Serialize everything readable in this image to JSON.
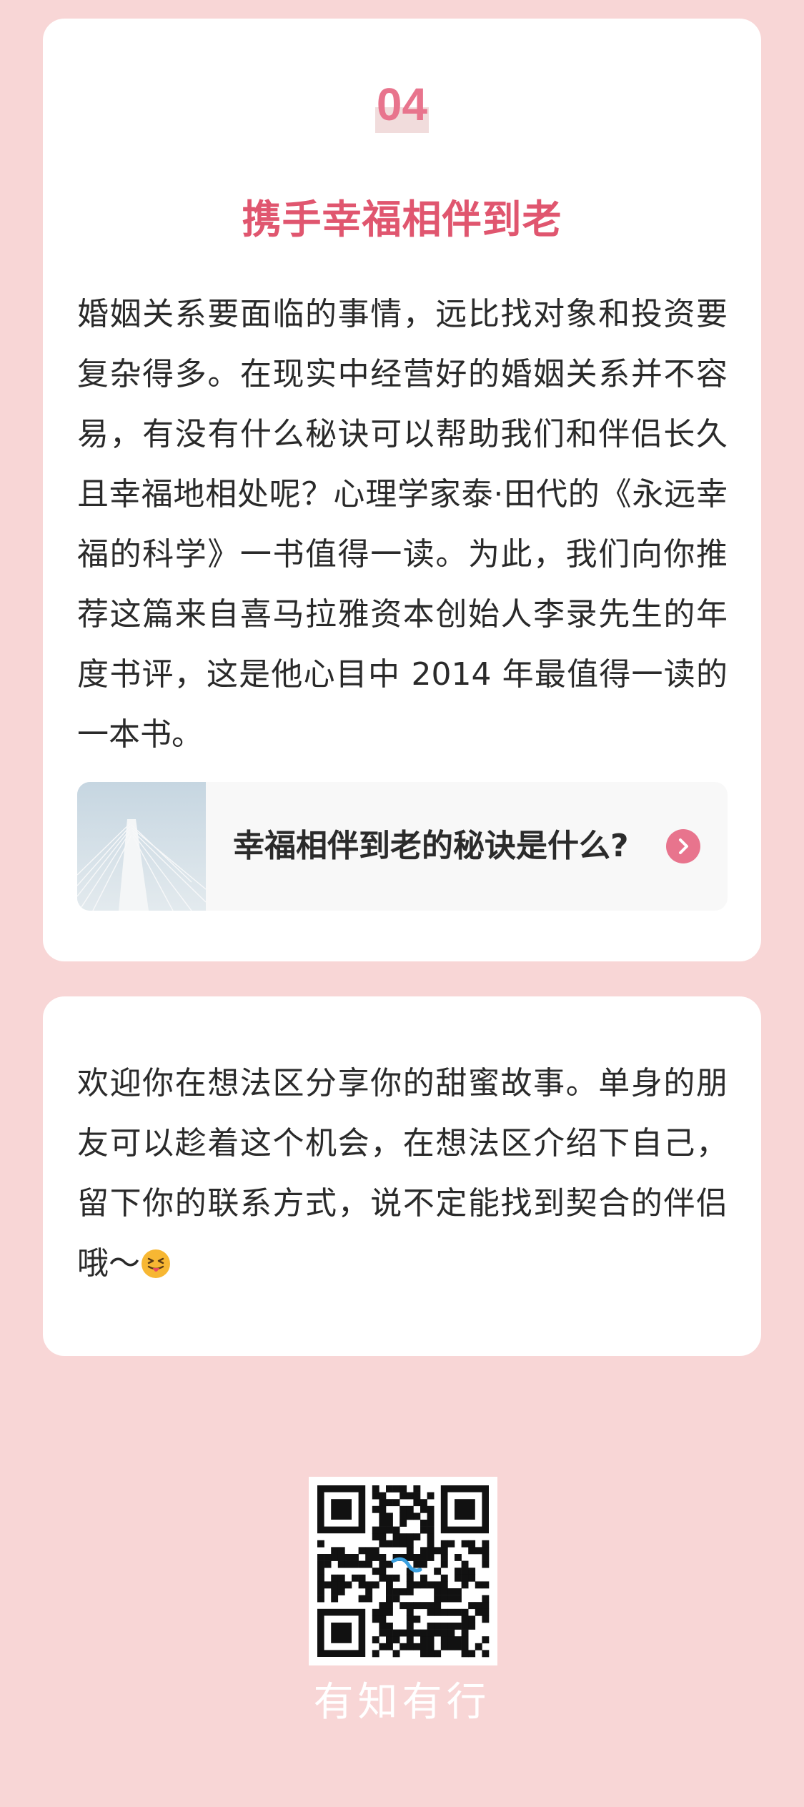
{
  "article": {
    "number": "04",
    "title": "携手幸福相伴到老",
    "paragraph": "婚姻关系要面临的事情，远比找对象和投资要复杂得多。在现实中经营好的婚姻关系并不容易，有没有什么秘诀可以帮助我们和伴侣长久且幸福地相处呢？心理学家泰·田代的《永远幸福的科学》一书值得一读。为此，我们向你推荐这篇来自喜马拉雅资本创始人李录先生的年度书评，这是他心目中 2014 年最值得一读的一本书。",
    "link": {
      "title": "幸福相伴到老的秘诀是什么?",
      "icon": "chevron-right-icon",
      "thumbnail": "bridge-photo"
    }
  },
  "invite": {
    "text": "欢迎你在想法区分享你的甜蜜故事。单身的朋友可以趁着这个机会，在想法区介绍下自己，留下你的联系方式，说不定能找到契合的伴侣哦～",
    "emoji": "tongue-wink-emoji"
  },
  "footer": {
    "qr_icon": "qr-code-icon",
    "brand": "有知有行"
  },
  "colors": {
    "page_bg": "#f8d6d6",
    "accent": "#e8748d",
    "title": "#e0566f",
    "card_bg": "#ffffff"
  }
}
